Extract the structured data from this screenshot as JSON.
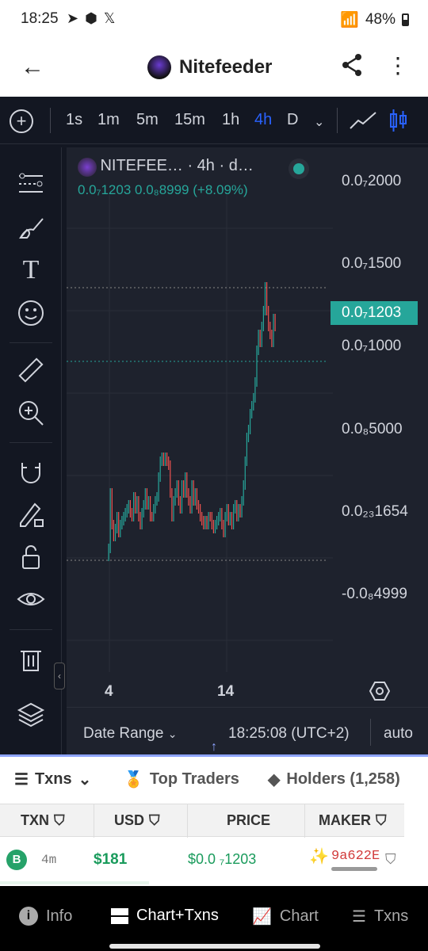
{
  "status": {
    "time": "18:25",
    "battery": "48%",
    "signal_icons": [
      "telegram-icon",
      "app-icon",
      "x-icon"
    ]
  },
  "app": {
    "title": "Nitefeeder"
  },
  "timeframes": [
    "1s",
    "1m",
    "5m",
    "15m",
    "1h",
    "4h",
    "D"
  ],
  "active_timeframe": "4h",
  "legend": {
    "symbol": "NITEFEE… · 4h · d…",
    "ohlc": "0.0₇1203  0.0₈8999 (+8.09%)"
  },
  "price_axis": [
    "0.0₇2000",
    "0.0₇1500",
    "0.0₇1000",
    "0.0₈5000",
    "0.0₂₃1654",
    "-0.0₈4999"
  ],
  "current_price": "0.0₇1203",
  "x_axis": [
    "4",
    "14"
  ],
  "chart_bottom": {
    "date_range": "Date Range",
    "clock": "18:25:08 (UTC+2)",
    "scale": "auto"
  },
  "tabs": {
    "txns": "Txns",
    "top_traders": "Top Traders",
    "holders": "Holders (1,258)"
  },
  "table": {
    "headers": [
      "TXN",
      "USD",
      "PRICE",
      "MAKER"
    ],
    "rows": [
      {
        "type": "B",
        "age": "4m",
        "usd": "$181",
        "price": "$0.0 ₇1203",
        "maker": "9a622E"
      }
    ]
  },
  "nav": {
    "info": "Info",
    "chart_txns": "Chart+Txns",
    "chart": "Chart",
    "txns": "Txns"
  },
  "colors": {
    "up": "#26a69a",
    "down": "#ef5350",
    "accent": "#2962ff",
    "bg": "#131722"
  }
}
